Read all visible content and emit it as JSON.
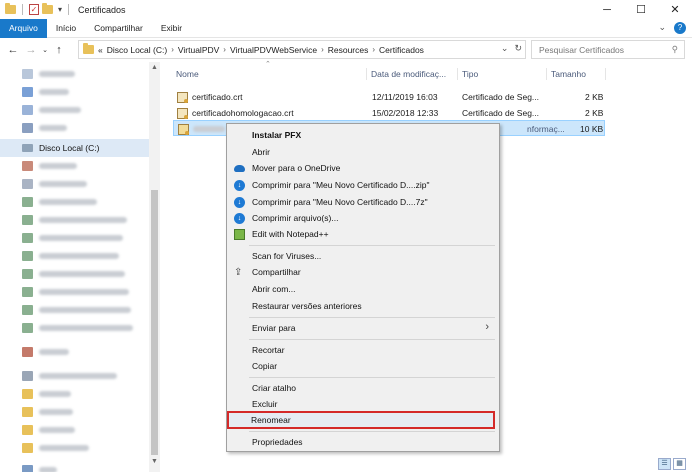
{
  "window": {
    "title": "Certificados",
    "buttons": [
      "minimize",
      "maximize",
      "close"
    ]
  },
  "ribbon": {
    "tabs": [
      "Arquivo",
      "Início",
      "Compartilhar",
      "Exibir"
    ],
    "active_tab": "Arquivo"
  },
  "address": {
    "prefix": "«",
    "crumbs": [
      "Disco Local (C:)",
      "VirtualPDV",
      "VirtualPDVWebService",
      "Resources",
      "Certificados"
    ],
    "search_placeholder": "Pesquisar Certificados"
  },
  "sidebar": {
    "selected_label": "Disco Local (C:)"
  },
  "filelist": {
    "columns": {
      "name": "Nome",
      "date": "Data de modificaç...",
      "type": "Tipo",
      "size": "Tamanho"
    },
    "rows": [
      {
        "name": "certificado.crt",
        "date": "12/11/2019 16:03",
        "type": "Certificado de Seg...",
        "size": "2 KB"
      },
      {
        "name": "certificadohomologacao.crt",
        "date": "15/02/2018 12:33",
        "type": "Certificado de Seg...",
        "size": "2 KB"
      },
      {
        "name": "",
        "date": "",
        "type": "nformaç...",
        "size": "10 KB"
      }
    ]
  },
  "context_menu": {
    "items": [
      {
        "label": "Instalar PFX",
        "bold": true
      },
      {
        "label": "Abrir"
      },
      {
        "label": "Mover para o OneDrive",
        "icon": "onedrive-icon"
      },
      {
        "label": "Comprimir para \"Meu Novo Certificado D....zip\"",
        "icon": "compress-icon"
      },
      {
        "label": "Comprimir para \"Meu Novo Certificado D....7z\"",
        "icon": "compress-icon"
      },
      {
        "label": "Comprimir arquivo(s)...",
        "icon": "compress-icon"
      },
      {
        "label": "Edit with Notepad++",
        "icon": "notepadpp-icon"
      },
      {
        "label": "Scan for Viruses..."
      },
      {
        "label": "Compartilhar",
        "icon": "share-icon"
      },
      {
        "label": "Abrir com..."
      },
      {
        "label": "Restaurar versões anteriores"
      },
      {
        "label": "Enviar para",
        "submenu": true
      },
      {
        "label": "Recortar"
      },
      {
        "label": "Copiar"
      },
      {
        "label": "Criar atalho"
      },
      {
        "label": "Excluir"
      },
      {
        "label": "Renomear",
        "highlighted": true
      },
      {
        "label": "Propriedades"
      }
    ]
  },
  "colors": {
    "accent": "#1979ca",
    "highlight_border": "#d42a2a",
    "selection": "#cce6fb"
  }
}
